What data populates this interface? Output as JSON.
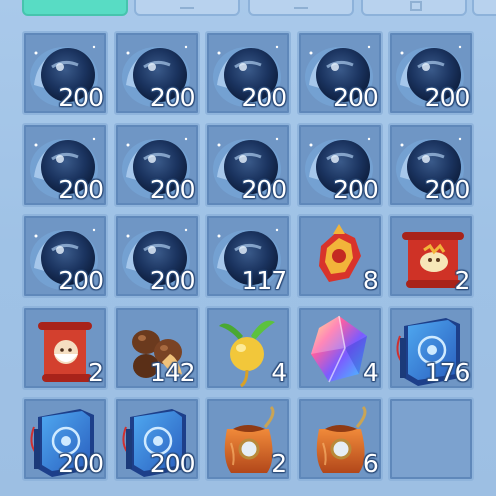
{
  "tabs": [
    {
      "name": "tab-1",
      "active": true
    },
    {
      "name": "tab-2",
      "active": false
    },
    {
      "name": "tab-3",
      "active": false
    },
    {
      "name": "tab-4",
      "active": false
    }
  ],
  "inventory": {
    "items": [
      {
        "icon": "blue-orb-icon",
        "count": "200"
      },
      {
        "icon": "blue-orb-icon",
        "count": "200"
      },
      {
        "icon": "blue-orb-icon",
        "count": "200"
      },
      {
        "icon": "blue-orb-icon",
        "count": "200"
      },
      {
        "icon": "blue-orb-icon",
        "count": "200"
      },
      {
        "icon": "blue-orb-icon",
        "count": "200"
      },
      {
        "icon": "blue-orb-icon",
        "count": "200"
      },
      {
        "icon": "blue-orb-icon",
        "count": "200"
      },
      {
        "icon": "blue-orb-icon",
        "count": "200"
      },
      {
        "icon": "blue-orb-icon",
        "count": "200"
      },
      {
        "icon": "blue-orb-icon",
        "count": "200"
      },
      {
        "icon": "blue-orb-icon",
        "count": "200"
      },
      {
        "icon": "blue-orb-icon",
        "count": "117"
      },
      {
        "icon": "red-gold-ornament-icon",
        "count": "8"
      },
      {
        "icon": "red-scroll-creature-icon",
        "count": "2"
      },
      {
        "icon": "red-scroll-elder-icon",
        "count": "2"
      },
      {
        "icon": "chestnuts-icon",
        "count": "142"
      },
      {
        "icon": "golden-radish-icon",
        "count": "4"
      },
      {
        "icon": "rainbow-crystal-icon",
        "count": "4"
      },
      {
        "icon": "blue-book-icon",
        "count": "176"
      },
      {
        "icon": "blue-book-icon",
        "count": "200"
      },
      {
        "icon": "blue-book-icon",
        "count": "200"
      },
      {
        "icon": "orange-pouch-icon",
        "count": "2"
      },
      {
        "icon": "orange-pouch-icon",
        "count": "6"
      },
      {
        "icon": "empty-slot",
        "count": ""
      }
    ]
  }
}
